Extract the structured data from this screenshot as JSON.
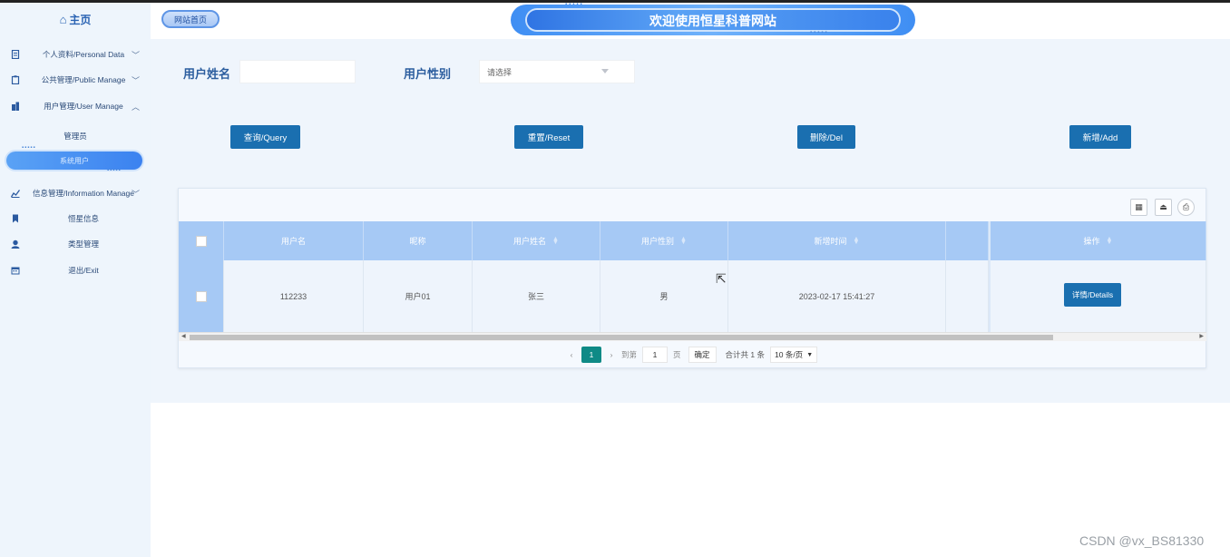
{
  "sidebar": {
    "home_label": "主页",
    "items": [
      {
        "label": "个人资料/Personal Data",
        "icon": "document-icon"
      },
      {
        "label": "公共管理/Public Manage",
        "icon": "clipboard-icon"
      },
      {
        "label": "用户管理/User Manage",
        "icon": "building-icon"
      },
      {
        "label": "信息管理/Information Manage",
        "icon": "chart-icon"
      }
    ],
    "user_sub": [
      "管理员",
      "系统用户"
    ],
    "info_sub": [
      {
        "label": "恒星信息",
        "icon": "bookmark-icon"
      },
      {
        "label": "类型管理",
        "icon": "user-group-icon"
      },
      {
        "label": "退出/Exit",
        "icon": "calendar-icon"
      }
    ]
  },
  "header": {
    "site_button": "网站首页",
    "title": "欢迎使用恒星科普网站"
  },
  "search": {
    "name_label": "用户姓名",
    "name_value": "",
    "gender_label": "用户性别",
    "gender_value": "请选择"
  },
  "actions": {
    "query": "查询/Query",
    "reset": "重置/Reset",
    "delete": "删除/Del",
    "add": "新增/Add"
  },
  "table": {
    "columns": [
      "用户名",
      "昵称",
      "用户姓名",
      "用户性别",
      "新增时间",
      "",
      "操作"
    ],
    "rows": [
      {
        "username": "112233",
        "nickname": "用户01",
        "realname": "张三",
        "gender": "男",
        "created": "2023-02-17 15:41:27",
        "action": "详情/Details"
      }
    ]
  },
  "pager": {
    "current": "1",
    "goto_label": "到第",
    "goto_value": "1",
    "page_unit": "页",
    "confirm": "确定",
    "total": "合计共 1 条",
    "page_size": "10 条/页"
  },
  "watermark": "CSDN @vx_BS81330",
  "colors": {
    "accent": "#1a6fb0",
    "header_row": "#a6c9f5",
    "pager_current": "#0f8a86"
  }
}
